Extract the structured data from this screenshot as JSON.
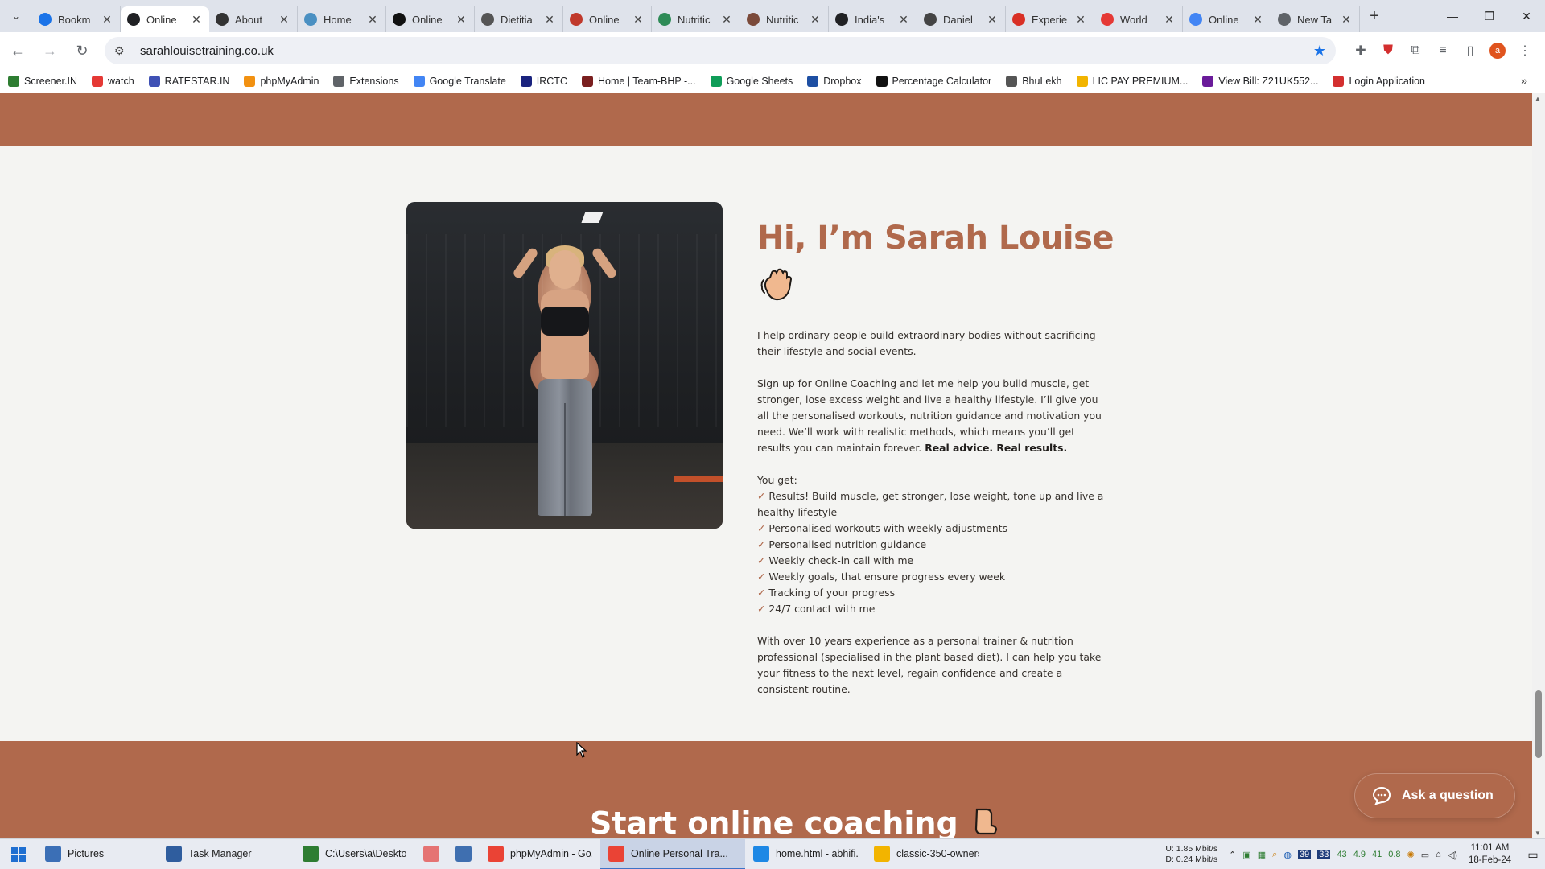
{
  "browser": {
    "tabs": [
      {
        "title": "Bookm",
        "icon": "bookmark-star-icon",
        "color": "#1a73e8"
      },
      {
        "title": "Online",
        "icon": "globe-icon",
        "color": "#202124",
        "active": true
      },
      {
        "title": "About",
        "icon": "site-logo-icon",
        "color": "#333333"
      },
      {
        "title": "Home",
        "icon": "globe-icon",
        "color": "#4a90c2"
      },
      {
        "title": "Online",
        "icon": "wix-icon",
        "color": "#111111"
      },
      {
        "title": "Dietitia",
        "icon": "site-logo-icon",
        "color": "#555555"
      },
      {
        "title": "Online",
        "icon": "site-logo-icon",
        "color": "#c0392b"
      },
      {
        "title": "Nutritic",
        "icon": "leaf-icon",
        "color": "#2e8b57"
      },
      {
        "title": "Nutritic",
        "icon": "avatar-icon",
        "color": "#7b4a3a"
      },
      {
        "title": "India's",
        "icon": "map-pin-icon",
        "color": "#202124"
      },
      {
        "title": "Daniel",
        "icon": "globe-icon",
        "color": "#444444"
      },
      {
        "title": "Experie",
        "icon": "site-logo-icon",
        "color": "#d93025"
      },
      {
        "title": "World",
        "icon": "site-logo-icon",
        "color": "#e53935"
      },
      {
        "title": "Online",
        "icon": "menu-lines-icon",
        "color": "#4285f4"
      },
      {
        "title": "New Ta",
        "icon": "globe-icon",
        "color": "#5f6368"
      }
    ],
    "address": "sarahlouisetraining.co.uk",
    "bookmarks": [
      {
        "label": "Screener.IN",
        "color": "#2e7d32"
      },
      {
        "label": "watch",
        "color": "#e53935"
      },
      {
        "label": "RATESTAR.IN",
        "color": "#3f51b5"
      },
      {
        "label": "phpMyAdmin",
        "color": "#f29111"
      },
      {
        "label": "Extensions",
        "color": "#5f6368"
      },
      {
        "label": "Google Translate",
        "color": "#4285f4"
      },
      {
        "label": "IRCTC",
        "color": "#1a237e"
      },
      {
        "label": "Home | Team-BHP -...",
        "color": "#7a1f1f"
      },
      {
        "label": "Google Sheets",
        "color": "#0f9d58"
      },
      {
        "label": "Dropbox",
        "color": "#1e4fa3"
      },
      {
        "label": "Percentage Calculator",
        "color": "#111111"
      },
      {
        "label": "BhuLekh",
        "color": "#555555"
      },
      {
        "label": "LIC PAY PREMIUM...",
        "color": "#f2b400"
      },
      {
        "label": "View Bill: Z21UK552...",
        "color": "#6a1b9a"
      },
      {
        "label": "Login Application",
        "color": "#d32f2f"
      }
    ]
  },
  "page": {
    "heading": "Hi, I’m Sarah Louise",
    "intro": "I help ordinary people build extraordinary bodies without sacrificing their lifestyle and social events.",
    "pitch": "Sign up for Online Coaching and let me help you build muscle, get stronger, lose excess weight and live a healthy lifestyle. I’ll give you all the personalised workouts, nutrition guidance and motivation you need. We’ll work with realistic methods, which means you’ll get results you can maintain forever.",
    "pitch_bold": "Real advice. Real results.",
    "you_get_label": "You get:",
    "benefits": [
      "Results! Build muscle, get stronger, lose weight, tone up and live a healthy lifestyle",
      "Personalised workouts with weekly adjustments",
      "Personalised nutrition guidance",
      "Weekly check-in call with me",
      "Weekly goals, that ensure progress every week",
      "Tracking of your progress",
      "24/7 contact with me"
    ],
    "tick": "✓",
    "experience": "With over 10 years experience as a personal trainer & nutrition professional (specialised in the plant based diet). I can help you take your fitness to the next level, regain confidence and create a consistent routine.",
    "cta_heading": "Start online coaching",
    "ask_label": "Ask a question",
    "accent_color": "#b0694c"
  },
  "taskbar": {
    "items": [
      {
        "label": "Pictures",
        "icon": "folder-icon",
        "color": "#3b6fb6"
      },
      {
        "label": "Task Manager",
        "icon": "task-manager-icon",
        "color": "#2f5d9e"
      },
      {
        "label": "C:\\Users\\a\\Desktop...",
        "icon": "notepad-icon",
        "color": "#2e7d32"
      },
      {
        "label": "",
        "icon": "app-icon",
        "color": "#e57373"
      },
      {
        "label": "",
        "icon": "document-icon",
        "color": "#3f6fb0"
      },
      {
        "label": "phpMyAdmin - Go...",
        "icon": "chrome-icon",
        "color": "#ea4335"
      },
      {
        "label": "Online Personal Tra...",
        "icon": "chrome-icon",
        "color": "#ea4335",
        "active": true
      },
      {
        "label": "home.html - abhifi...",
        "icon": "vscode-icon",
        "color": "#1e88e5"
      },
      {
        "label": "classic-350-owners...",
        "icon": "file-icon",
        "color": "#f2b400"
      }
    ],
    "net_up_label": "U:",
    "net_up": "1.85 Mbit/s",
    "net_down_label": "D:",
    "net_down": "0.24 Mbit/s",
    "tray_values": [
      "43",
      "4.9",
      "41",
      "0.8"
    ],
    "time": "11:01 AM",
    "date": "18-Feb-24"
  }
}
